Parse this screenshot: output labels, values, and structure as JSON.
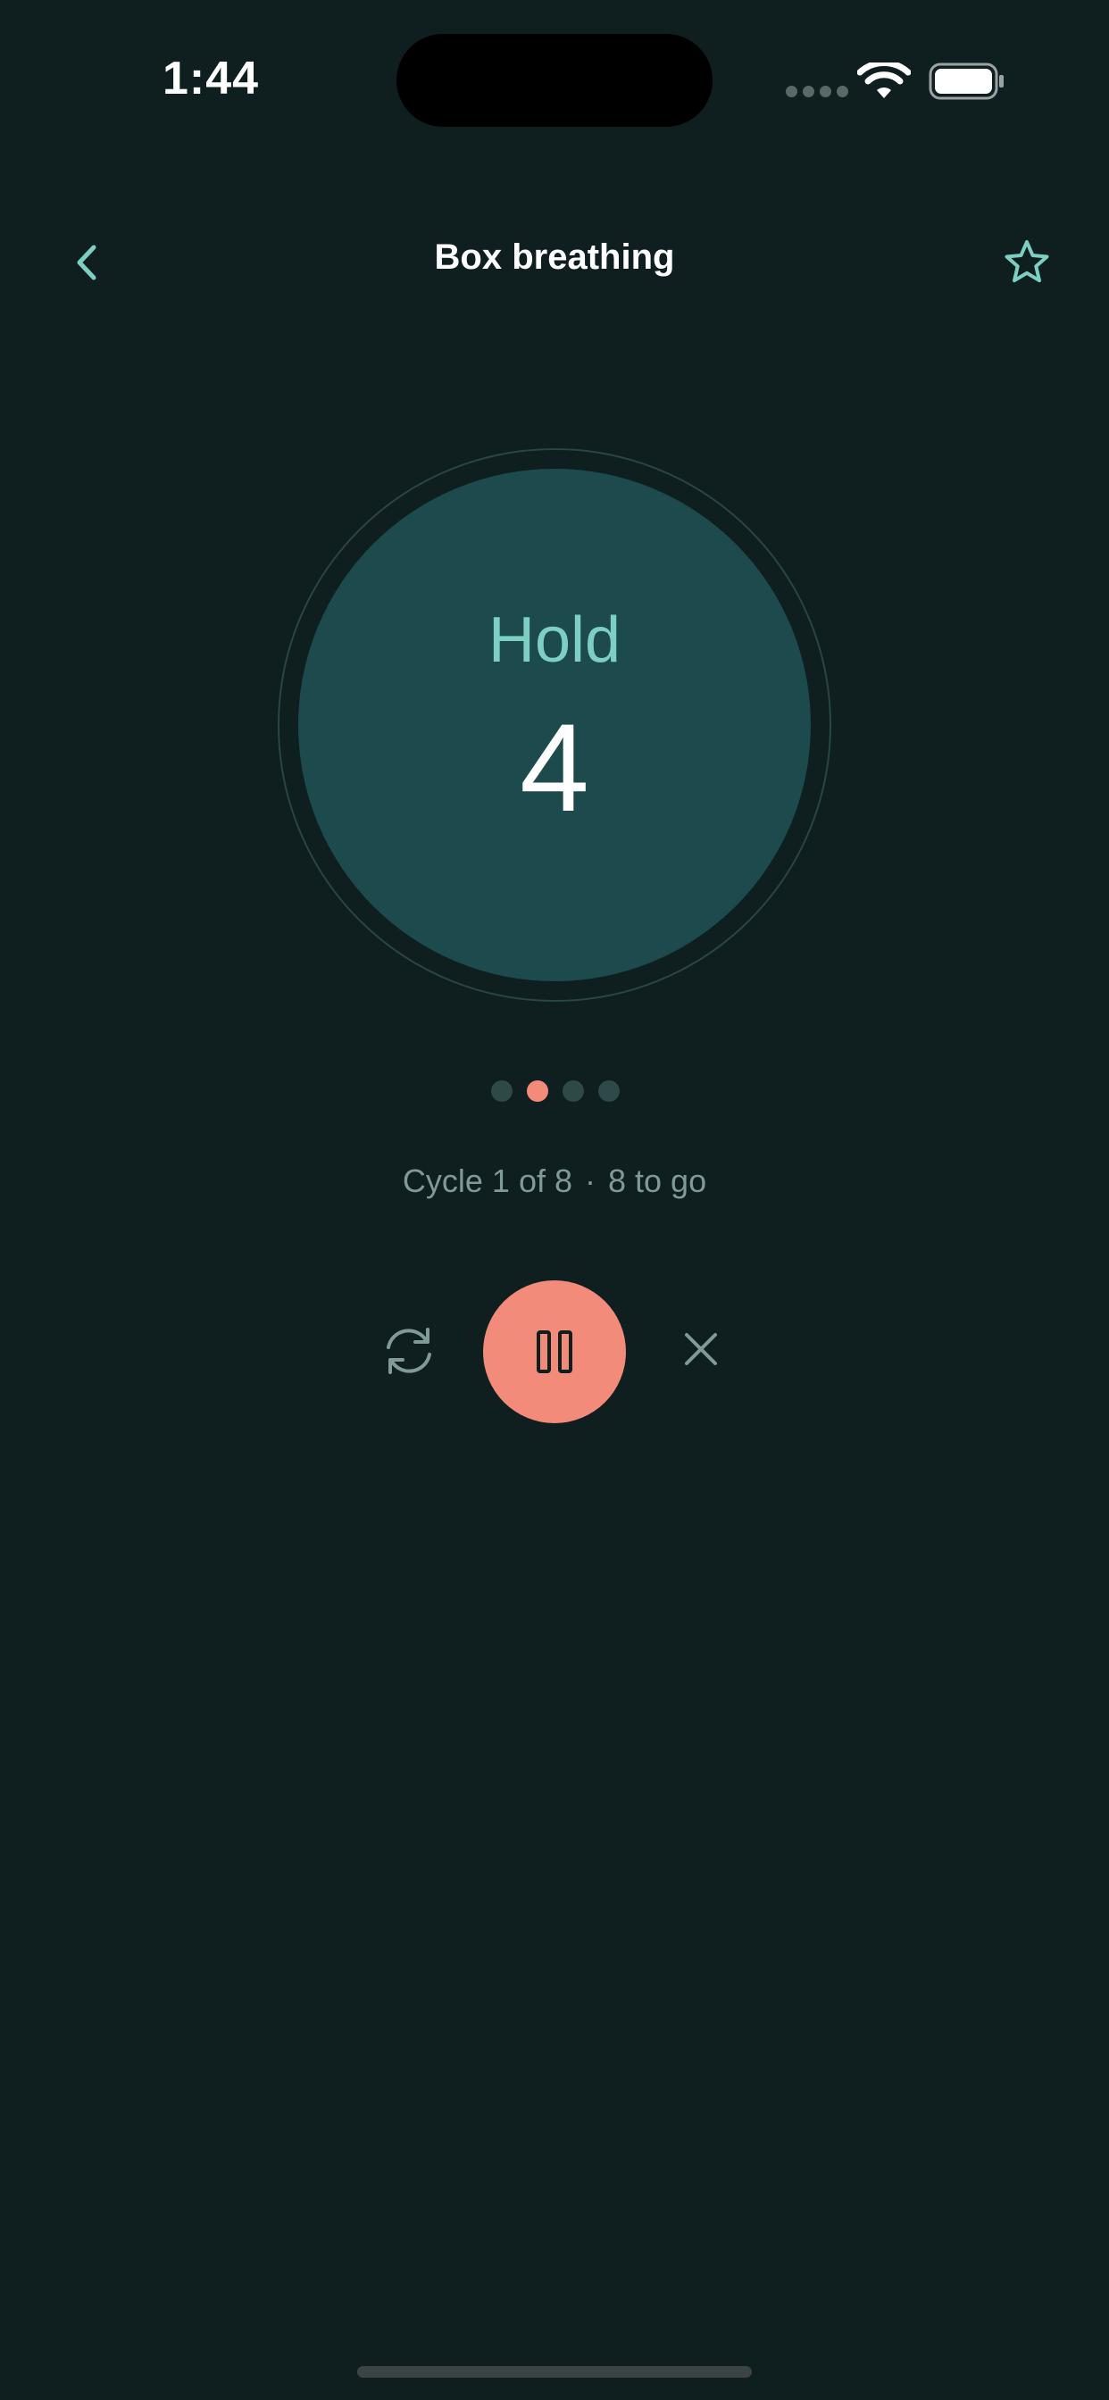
{
  "status_bar": {
    "time": "1:44"
  },
  "nav": {
    "title": "Box breathing"
  },
  "breathing": {
    "phase": "Hold",
    "count": "4",
    "phase_count": 4,
    "active_phase_index": 1
  },
  "progress": {
    "cycle_label": "Cycle 1 of 8",
    "separator": "·",
    "remaining_label": "8 to go"
  },
  "colors": {
    "background": "#0f1e1e",
    "accent_teal": "#7ecfc3",
    "circle_fill": "#1d4b4d",
    "accent_coral": "#f38b7a",
    "muted_text": "#7f9a98"
  },
  "icons": {
    "back": "chevron-left-icon",
    "favorite": "star-icon",
    "restart": "refresh-icon",
    "pause": "pause-icon",
    "close": "close-icon",
    "wifi": "wifi-icon",
    "battery": "battery-icon"
  }
}
